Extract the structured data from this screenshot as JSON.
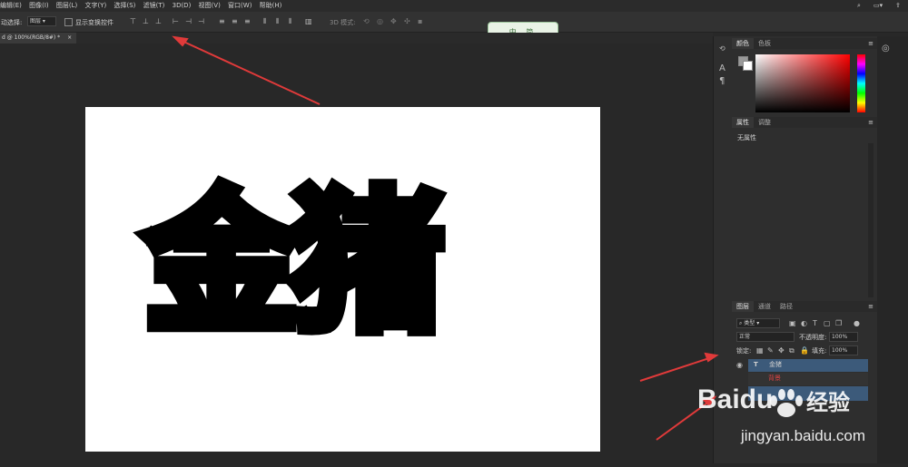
{
  "menu": [
    "编辑(E)",
    "图像(I)",
    "图层(L)",
    "文字(Y)",
    "选择(S)",
    "滤镜(T)",
    "3D(D)",
    "视图(V)",
    "窗口(W)",
    "帮助(H)"
  ],
  "options": {
    "auto_select_label": "动选择:",
    "auto_select_value": "图层",
    "show_transform": "显示变换控件",
    "mode_3d": "3D 模式:"
  },
  "pill": {
    "text": "中 简"
  },
  "document": {
    "tab_title": "d @ 100%(RGB/8#) *",
    "close": "×",
    "canvas_text": "金猪"
  },
  "color_panel": {
    "tabs": [
      "颜色",
      "色板"
    ],
    "foreground": "#9a9a9a",
    "background": "#ffffff"
  },
  "properties_panel": {
    "tabs": [
      "属性",
      "调整"
    ],
    "content": "无属性"
  },
  "layers_panel": {
    "tabs": [
      "图层",
      "通道",
      "路径"
    ],
    "kind_filter": "类型",
    "blend_mode": "正常",
    "opacity_label": "不透明度:",
    "opacity_value": "100%",
    "lock_label": "锁定:",
    "fill_label": "填充:",
    "fill_value": "100%",
    "layers": [
      {
        "name": "金猪",
        "type": "T"
      },
      {
        "name": "背景",
        "type": ""
      }
    ]
  },
  "watermark": {
    "brand": "Baidu",
    "brand_cn": "经验",
    "url": "jingyan.baidu.com"
  },
  "colors": {
    "annotation_arrow": "#e03a3a",
    "layer_selected": "#3c5a7a"
  }
}
